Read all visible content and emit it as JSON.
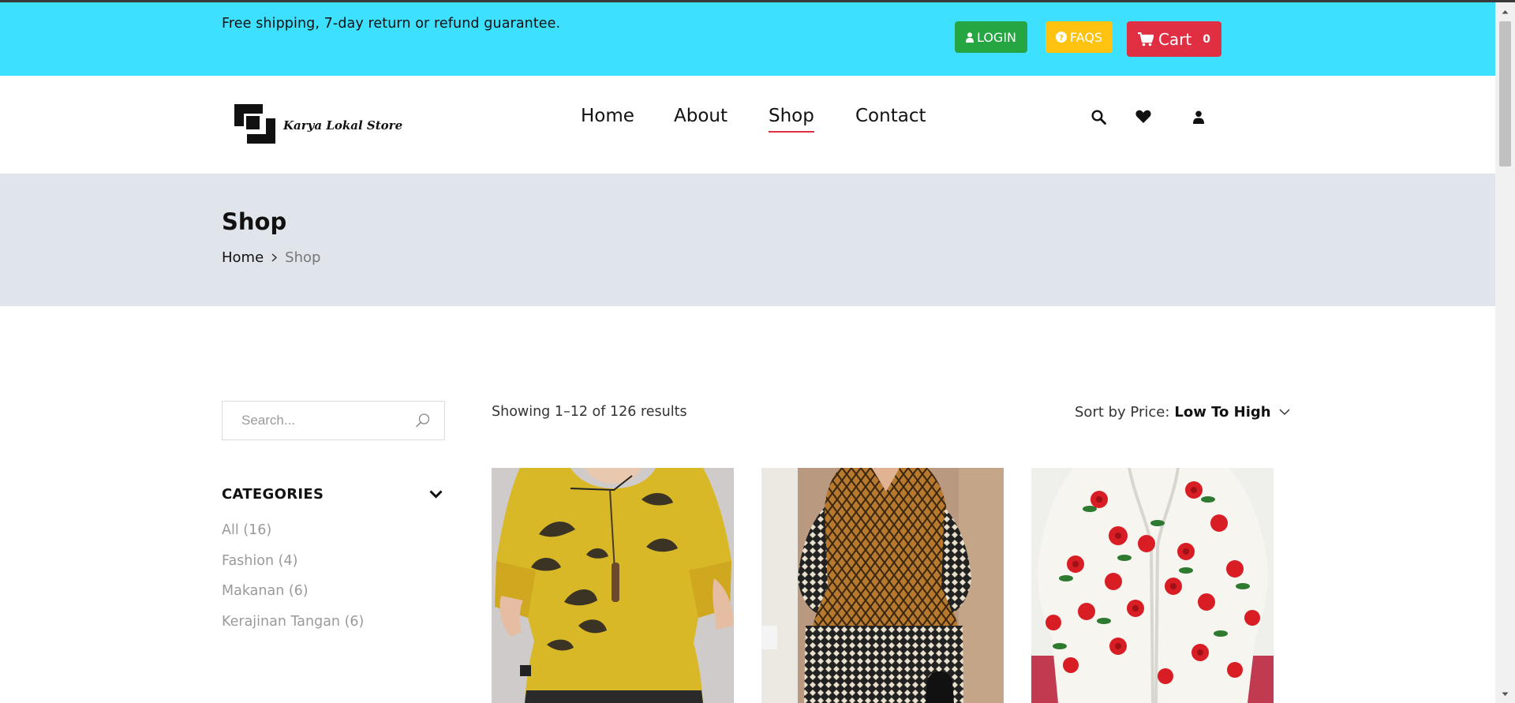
{
  "topbar": {
    "message": "Free shipping, 7-day return or refund guarantee.",
    "login_label": "LOGIN",
    "faqs_label": "FAQS",
    "cart_label": "Cart",
    "cart_count": "0",
    "colors": {
      "bar": "#3de0fe",
      "login": "#26a643",
      "faqs": "#fec310",
      "cart": "#e02f43"
    }
  },
  "header": {
    "logo_text": "Karya Lokal Store",
    "nav": [
      {
        "label": "Home",
        "active": false
      },
      {
        "label": "About",
        "active": false
      },
      {
        "label": "Shop",
        "active": true
      },
      {
        "label": "Contact",
        "active": false
      }
    ],
    "icons": [
      "search-icon",
      "heart-icon",
      "user-icon"
    ]
  },
  "page": {
    "title": "Shop",
    "breadcrumb": {
      "home": "Home",
      "current": "Shop"
    }
  },
  "sidebar": {
    "search_placeholder": "Search...",
    "categories_title": "CATEGORIES",
    "categories": [
      {
        "label": "All (16)"
      },
      {
        "label": "Fashion (4)"
      },
      {
        "label": "Makanan (6)"
      },
      {
        "label": "Kerajinan Tangan (6)"
      }
    ]
  },
  "results": {
    "summary": "Showing 1–12 of 126 results",
    "sort_label": "Sort by Price:",
    "sort_value": "Low To High"
  },
  "products": [
    {
      "image": "yellow-leaf-print-blouse"
    },
    {
      "image": "brown-geometric-pattern-dress"
    },
    {
      "image": "white-knit-cardigan-with-red-roses"
    }
  ]
}
